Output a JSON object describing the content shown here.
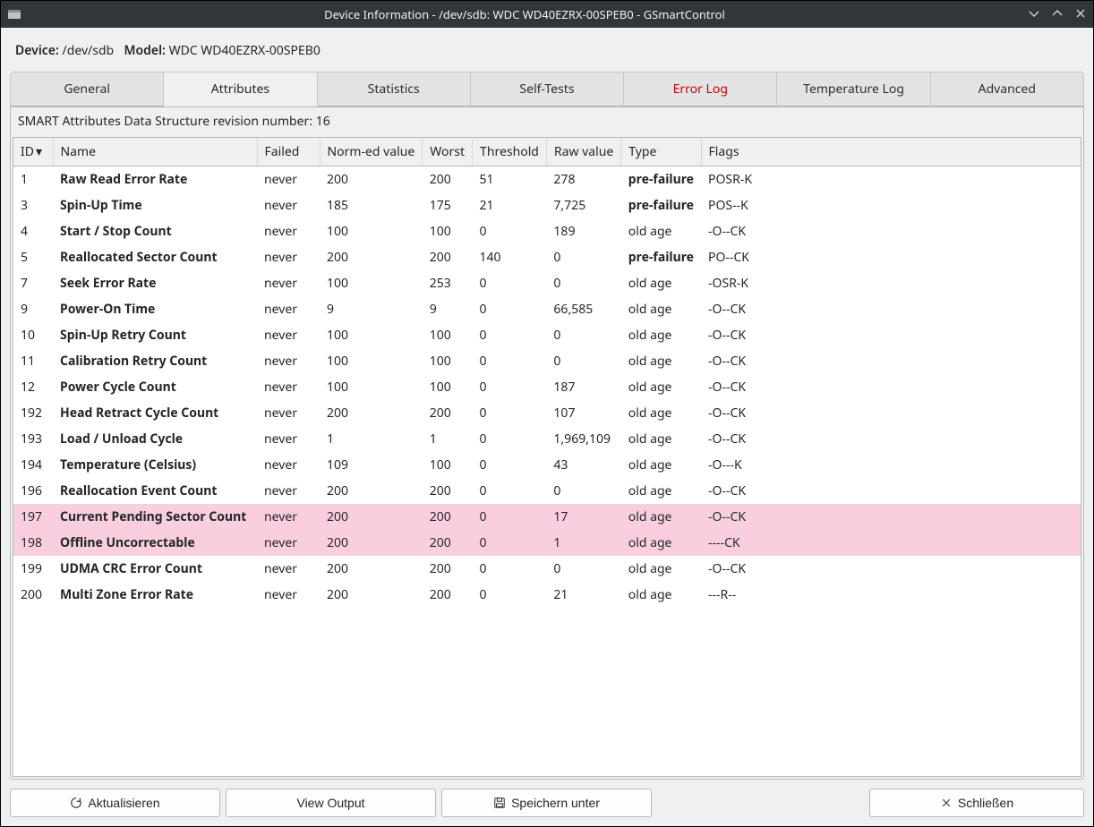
{
  "titlebar": {
    "title": "Device Information - /dev/sdb: WDC WD40EZRX-00SPEB0 - GSmartControl"
  },
  "info": {
    "device_label": "Device:",
    "device_value": "/dev/sdb",
    "model_label": "Model:",
    "model_value": "WDC WD40EZRX-00SPEB0"
  },
  "tabs": {
    "general": "General",
    "attributes": "Attributes",
    "statistics": "Statistics",
    "selftests": "Self-Tests",
    "errorlog": "Error Log",
    "temperature": "Temperature Log",
    "advanced": "Advanced"
  },
  "revision_line": "SMART Attributes Data Structure revision number: 16",
  "columns": {
    "id": "ID",
    "name": "Name",
    "failed": "Failed",
    "norm": "Norm-ed value",
    "worst": "Worst",
    "threshold": "Threshold",
    "raw": "Raw value",
    "type": "Type",
    "flags": "Flags"
  },
  "rows": [
    {
      "id": "1",
      "name": "Raw Read Error Rate",
      "failed": "never",
      "norm": "200",
      "worst": "200",
      "threshold": "51",
      "raw": "278",
      "type": "pre-failure",
      "flags": "POSR-K",
      "warn": false
    },
    {
      "id": "3",
      "name": "Spin-Up Time",
      "failed": "never",
      "norm": "185",
      "worst": "175",
      "threshold": "21",
      "raw": "7,725",
      "type": "pre-failure",
      "flags": "POS--K",
      "warn": false
    },
    {
      "id": "4",
      "name": "Start / Stop Count",
      "failed": "never",
      "norm": "100",
      "worst": "100",
      "threshold": "0",
      "raw": "189",
      "type": "old age",
      "flags": "-O--CK",
      "warn": false
    },
    {
      "id": "5",
      "name": "Reallocated Sector Count",
      "failed": "never",
      "norm": "200",
      "worst": "200",
      "threshold": "140",
      "raw": "0",
      "type": "pre-failure",
      "flags": "PO--CK",
      "warn": false
    },
    {
      "id": "7",
      "name": "Seek Error Rate",
      "failed": "never",
      "norm": "100",
      "worst": "253",
      "threshold": "0",
      "raw": "0",
      "type": "old age",
      "flags": "-OSR-K",
      "warn": false
    },
    {
      "id": "9",
      "name": "Power-On Time",
      "failed": "never",
      "norm": "9",
      "worst": "9",
      "threshold": "0",
      "raw": "66,585",
      "type": "old age",
      "flags": "-O--CK",
      "warn": false
    },
    {
      "id": "10",
      "name": "Spin-Up Retry Count",
      "failed": "never",
      "norm": "100",
      "worst": "100",
      "threshold": "0",
      "raw": "0",
      "type": "old age",
      "flags": "-O--CK",
      "warn": false
    },
    {
      "id": "11",
      "name": "Calibration Retry Count",
      "failed": "never",
      "norm": "100",
      "worst": "100",
      "threshold": "0",
      "raw": "0",
      "type": "old age",
      "flags": "-O--CK",
      "warn": false
    },
    {
      "id": "12",
      "name": "Power Cycle Count",
      "failed": "never",
      "norm": "100",
      "worst": "100",
      "threshold": "0",
      "raw": "187",
      "type": "old age",
      "flags": "-O--CK",
      "warn": false
    },
    {
      "id": "192",
      "name": "Head Retract Cycle Count",
      "failed": "never",
      "norm": "200",
      "worst": "200",
      "threshold": "0",
      "raw": "107",
      "type": "old age",
      "flags": "-O--CK",
      "warn": false
    },
    {
      "id": "193",
      "name": "Load / Unload Cycle",
      "failed": "never",
      "norm": "1",
      "worst": "1",
      "threshold": "0",
      "raw": "1,969,109",
      "type": "old age",
      "flags": "-O--CK",
      "warn": false
    },
    {
      "id": "194",
      "name": "Temperature (Celsius)",
      "failed": "never",
      "norm": "109",
      "worst": "100",
      "threshold": "0",
      "raw": "43",
      "type": "old age",
      "flags": "-O---K",
      "warn": false
    },
    {
      "id": "196",
      "name": "Reallocation Event Count",
      "failed": "never",
      "norm": "200",
      "worst": "200",
      "threshold": "0",
      "raw": "0",
      "type": "old age",
      "flags": "-O--CK",
      "warn": false
    },
    {
      "id": "197",
      "name": "Current Pending Sector Count",
      "failed": "never",
      "norm": "200",
      "worst": "200",
      "threshold": "0",
      "raw": "17",
      "type": "old age",
      "flags": "-O--CK",
      "warn": true
    },
    {
      "id": "198",
      "name": "Offline Uncorrectable",
      "failed": "never",
      "norm": "200",
      "worst": "200",
      "threshold": "0",
      "raw": "1",
      "type": "old age",
      "flags": "----CK",
      "warn": true
    },
    {
      "id": "199",
      "name": "UDMA CRC Error Count",
      "failed": "never",
      "norm": "200",
      "worst": "200",
      "threshold": "0",
      "raw": "0",
      "type": "old age",
      "flags": "-O--CK",
      "warn": false
    },
    {
      "id": "200",
      "name": "Multi Zone Error Rate",
      "failed": "never",
      "norm": "200",
      "worst": "200",
      "threshold": "0",
      "raw": "21",
      "type": "old age",
      "flags": "---R--",
      "warn": false
    }
  ],
  "buttons": {
    "refresh": "Aktualisieren",
    "view_output": "View Output",
    "save_as": "Speichern unter",
    "close": "Schließen"
  }
}
